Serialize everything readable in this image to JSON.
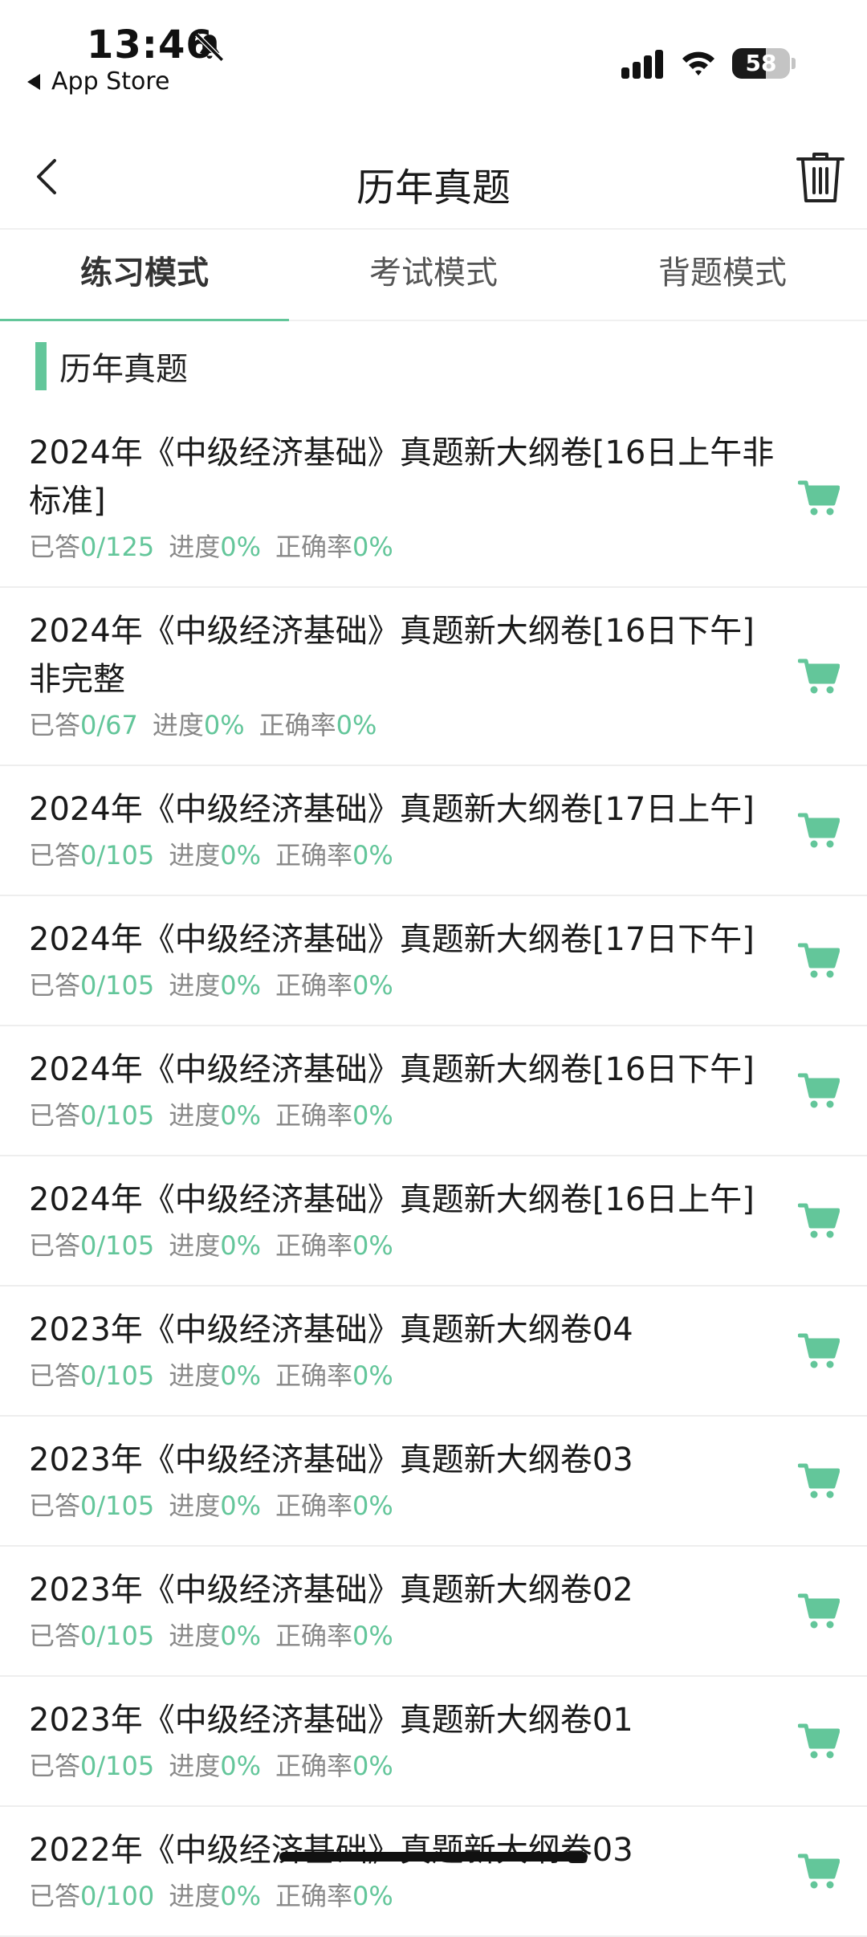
{
  "status_bar": {
    "time": "13:46",
    "back_app": "App Store",
    "battery": "58",
    "battery_level": 0.58
  },
  "nav": {
    "title": "历年真题"
  },
  "tabs": [
    {
      "label": "练习模式",
      "active": true
    },
    {
      "label": "考试模式",
      "active": false
    },
    {
      "label": "背题模式",
      "active": false
    }
  ],
  "section": {
    "title": "历年真题"
  },
  "meta_labels": {
    "answered": "已答",
    "progress": "进度",
    "accuracy": "正确率"
  },
  "items": [
    {
      "title": "2024年《中级经济基础》真题新大纲卷[16日上午非标准]",
      "answered": "0/125",
      "progress": "0%",
      "accuracy": "0%"
    },
    {
      "title": "2024年《中级经济基础》真题新大纲卷[16日下午]非完整",
      "answered": "0/67",
      "progress": "0%",
      "accuracy": "0%"
    },
    {
      "title": "2024年《中级经济基础》真题新大纲卷[17日上午]",
      "answered": "0/105",
      "progress": "0%",
      "accuracy": "0%"
    },
    {
      "title": "2024年《中级经济基础》真题新大纲卷[17日下午]",
      "answered": "0/105",
      "progress": "0%",
      "accuracy": "0%"
    },
    {
      "title": "2024年《中级经济基础》真题新大纲卷[16日下午]",
      "answered": "0/105",
      "progress": "0%",
      "accuracy": "0%"
    },
    {
      "title": "2024年《中级经济基础》真题新大纲卷[16日上午]",
      "answered": "0/105",
      "progress": "0%",
      "accuracy": "0%"
    },
    {
      "title": "2023年《中级经济基础》真题新大纲卷04",
      "answered": "0/105",
      "progress": "0%",
      "accuracy": "0%"
    },
    {
      "title": "2023年《中级经济基础》真题新大纲卷03",
      "answered": "0/105",
      "progress": "0%",
      "accuracy": "0%"
    },
    {
      "title": "2023年《中级经济基础》真题新大纲卷02",
      "answered": "0/105",
      "progress": "0%",
      "accuracy": "0%"
    },
    {
      "title": "2023年《中级经济基础》真题新大纲卷01",
      "answered": "0/105",
      "progress": "0%",
      "accuracy": "0%"
    },
    {
      "title": "2022年《中级经济基础》真题新大纲卷03",
      "answered": "0/100",
      "progress": "0%",
      "accuracy": "0%"
    }
  ],
  "colors": {
    "accent": "#63c69a",
    "text": "#1a1a1a",
    "muted": "#888888"
  },
  "icons": {
    "back": "chevron-left-icon",
    "trash": "trash-icon",
    "cart": "cart-icon"
  }
}
